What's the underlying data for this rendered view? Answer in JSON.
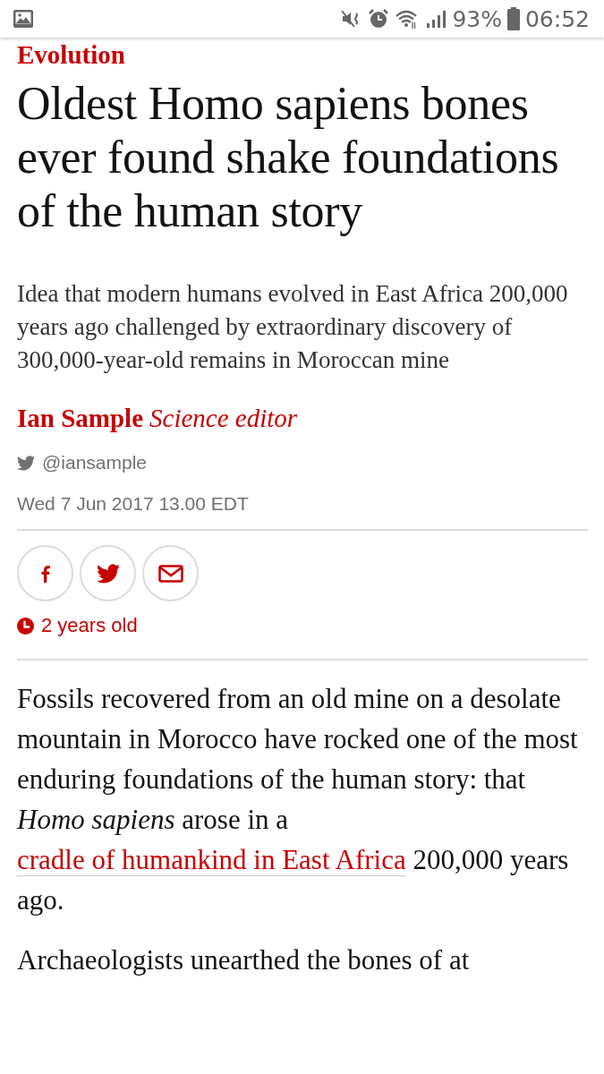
{
  "status_bar": {
    "battery": "93%",
    "time": "06:52"
  },
  "article": {
    "section": "Evolution",
    "headline": "Oldest Homo sapiens bones ever found shake foundations of the human story",
    "standfirst": "Idea that modern humans evolved in East Africa 200,000 years ago challenged by extraordinary discovery of 300,000-year-old remains in Moroccan mine",
    "author": "Ian Sample",
    "author_role": "Science editor",
    "twitter": "@iansample",
    "date": "Wed 7 Jun 2017 13.00 EDT",
    "share_buttons": [
      {
        "kind": "facebook"
      },
      {
        "kind": "twitter"
      },
      {
        "kind": "email"
      }
    ],
    "age": "2 years old",
    "paragraphs": [
      {
        "parts": [
          {
            "kind": "text",
            "text": "Fossils recovered from an old mine on a desolate mountain in Morocco have rocked one of the most enduring foundations of the human story: that *Homo sapiens* arose in a "
          },
          {
            "kind": "link",
            "text": "cradle of humankind in East Africa"
          },
          {
            "kind": "text",
            "text": " 200,000 years ago."
          }
        ]
      },
      {
        "parts": [
          {
            "kind": "text",
            "text": "Archaeologists unearthed the bones of at"
          }
        ]
      }
    ]
  }
}
